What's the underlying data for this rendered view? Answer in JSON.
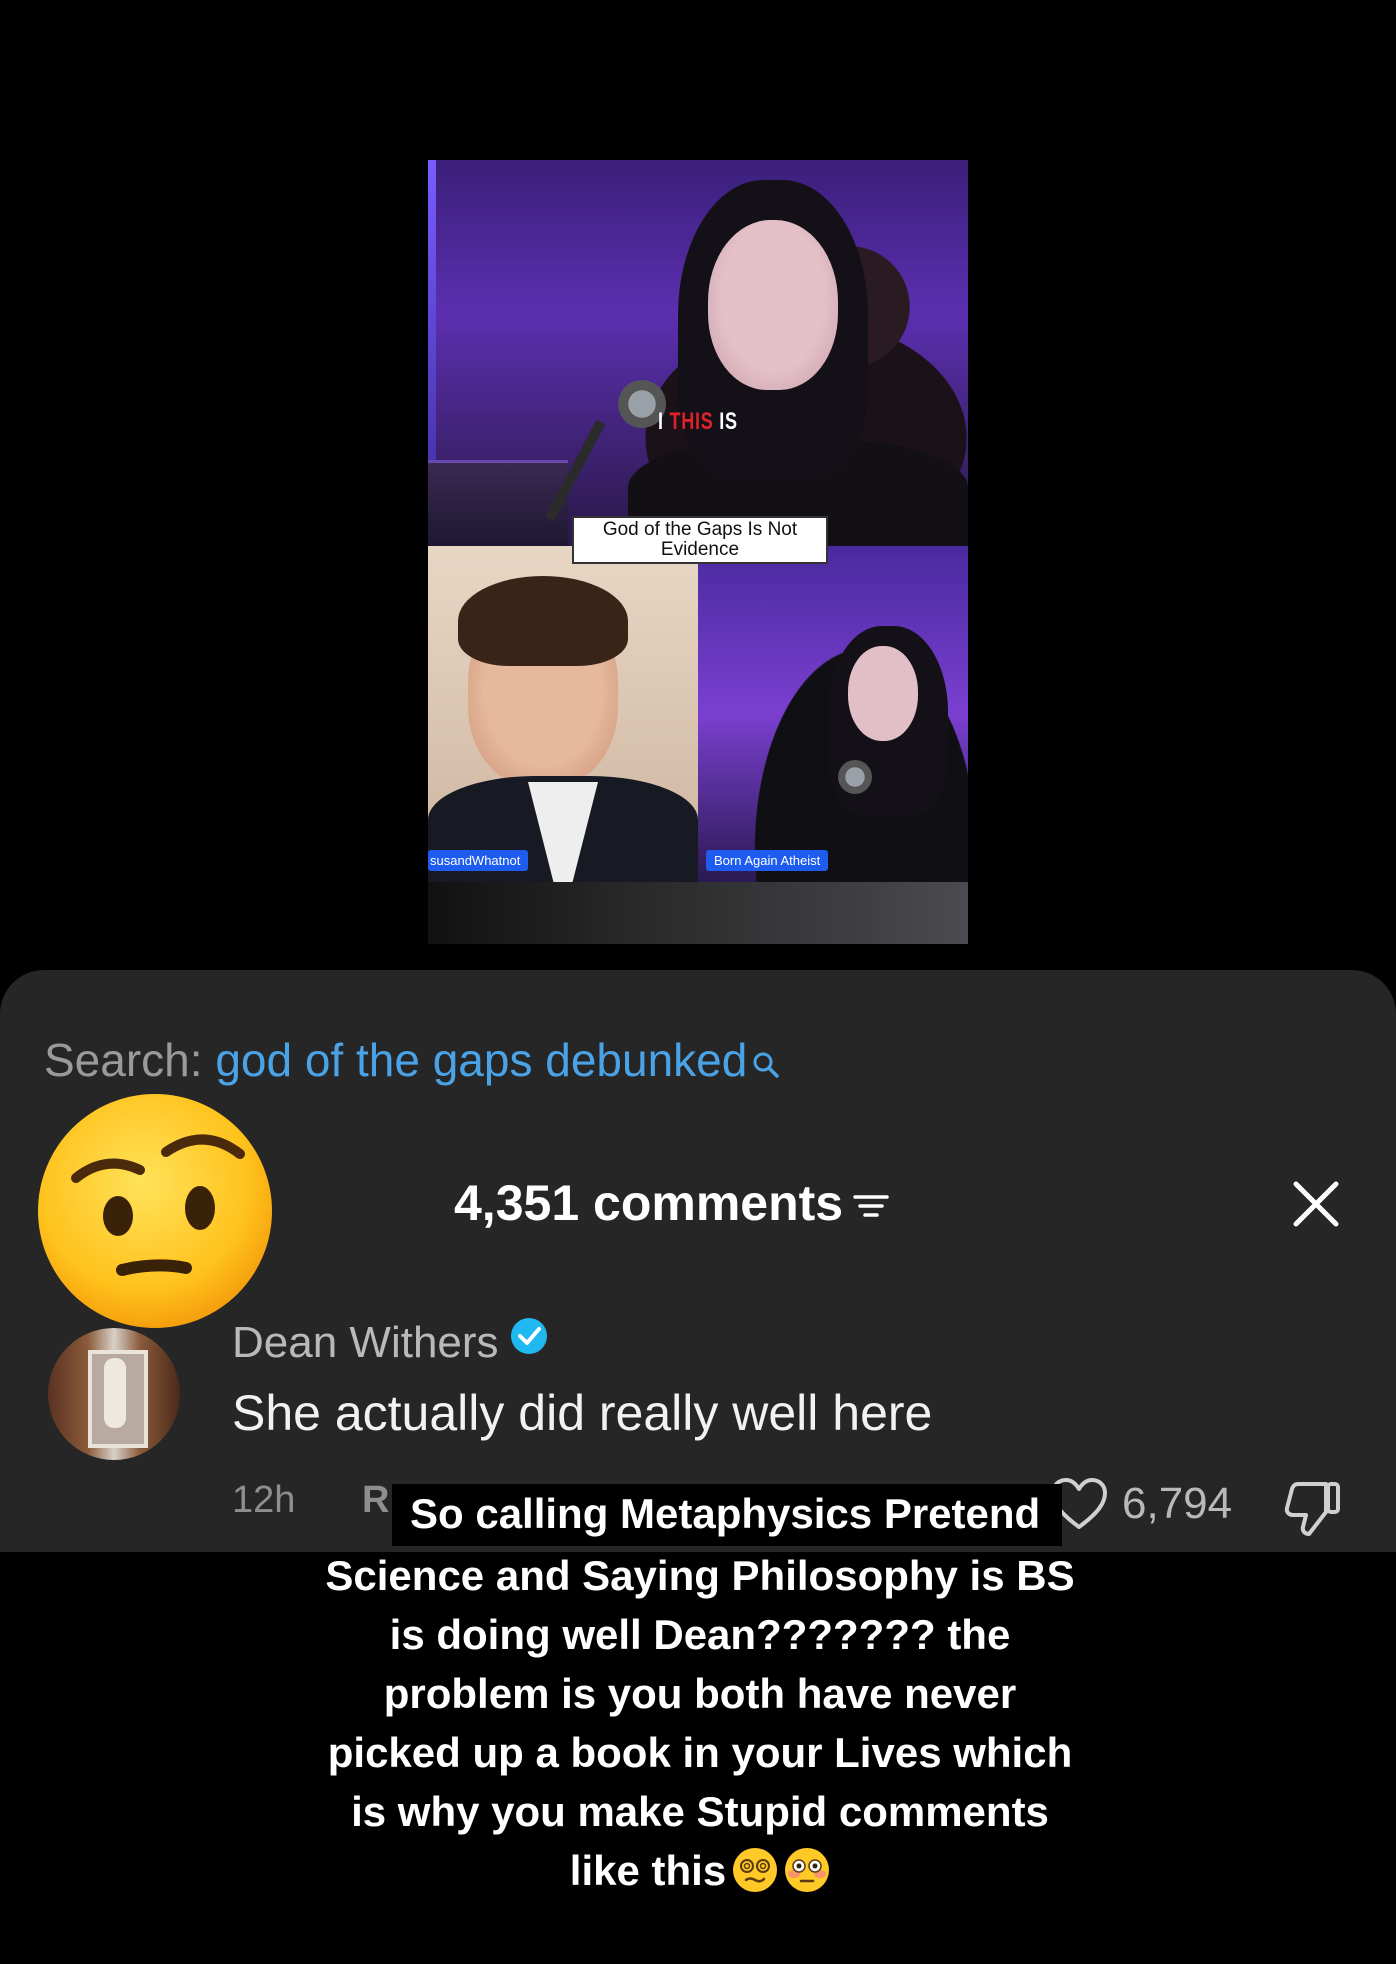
{
  "video": {
    "caption_prefix": "I ",
    "caption_highlight": "THIS",
    "caption_suffix": " IS",
    "caption_box": "God of the Gaps Is Not Evidence",
    "left_name_tag": "susandWhatnot",
    "right_name_tag": "Born Again Atheist"
  },
  "search": {
    "prefix": "Search: ",
    "query": "god of the gaps debunked",
    "icon": "search-icon"
  },
  "reaction_emoji": "face-with-raised-eyebrow",
  "comments_header": {
    "count_label": "4,351 comments",
    "sort_icon": "sort-icon",
    "close_icon": "close-icon"
  },
  "comment": {
    "author": "Dean Withers",
    "verified": true,
    "text": "She actually did really well here",
    "time": "12h",
    "reply_partial": "R",
    "likes": "6,794",
    "like_icon": "heart-icon",
    "dislike_icon": "thumbs-down-icon"
  },
  "overlay": {
    "first_line": "So calling Metaphysics Pretend",
    "lines": [
      "Science and Saying Philosophy is BS",
      "is doing well Dean??????? the",
      "problem is you both have never",
      "picked up a book in your Lives which",
      "is why you make Stupid comments"
    ],
    "last_line": "like this",
    "end_emojis": [
      "woozy-face",
      "flushed-face"
    ]
  },
  "colors": {
    "background": "#000000",
    "sheet": "#262626",
    "search_query": "#4aa3e6",
    "verified": "#20b8f0",
    "muted_text": "#8e8e8e"
  }
}
